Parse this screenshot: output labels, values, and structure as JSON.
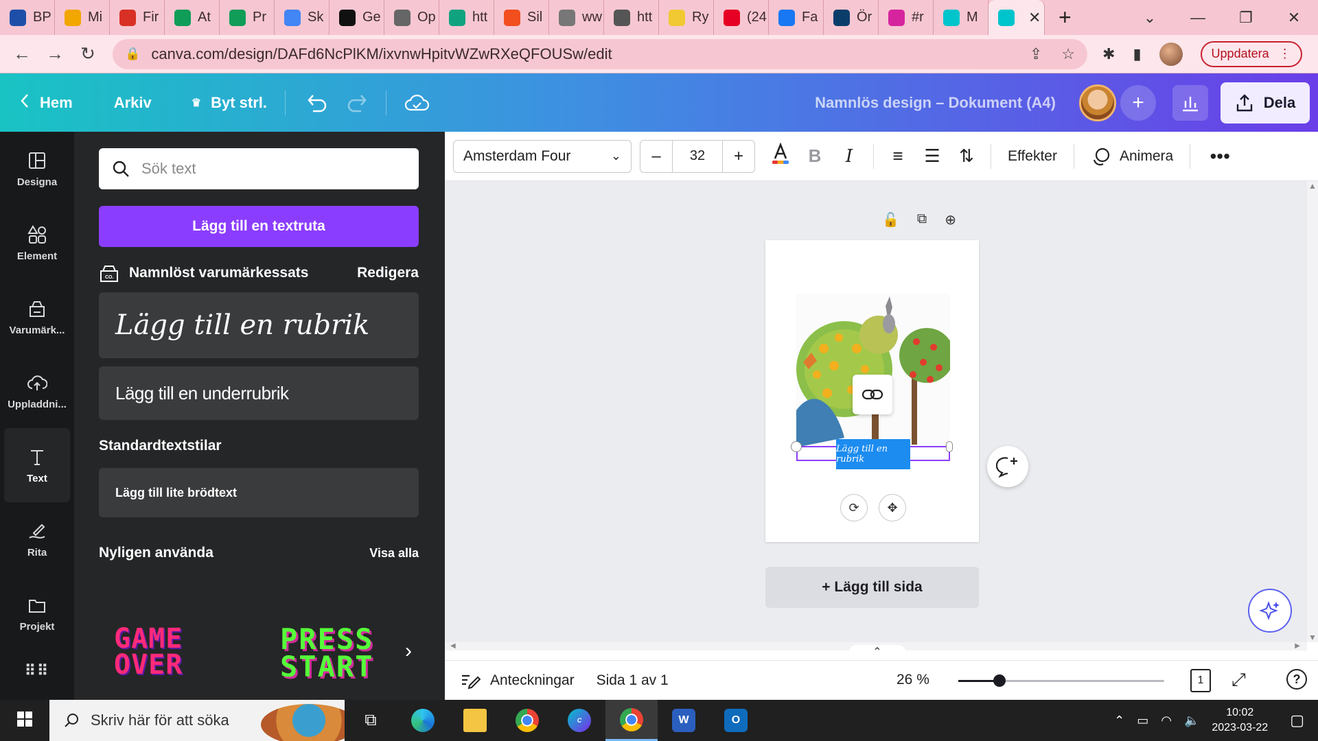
{
  "browser": {
    "tabs": [
      {
        "label": "BP",
        "icon": "bp-icon",
        "color": "#1e4fa8"
      },
      {
        "label": "Mi",
        "icon": "drive-icon",
        "color": "#f2a600"
      },
      {
        "label": "Fir",
        "icon": "gmail-icon",
        "color": "#d93025"
      },
      {
        "label": "At",
        "icon": "sheets-icon",
        "color": "#0f9d58"
      },
      {
        "label": "Pr",
        "icon": "sheets-icon",
        "color": "#0f9d58"
      },
      {
        "label": "Sk",
        "icon": "docs-icon",
        "color": "#4285f4"
      },
      {
        "label": "Ge",
        "icon": "notion-icon",
        "color": "#111111"
      },
      {
        "label": "Op",
        "icon": "book-icon",
        "color": "#666666"
      },
      {
        "label": "htt",
        "icon": "chatgpt-icon",
        "color": "#10a37f"
      },
      {
        "label": "Sil",
        "icon": "f-icon",
        "color": "#f24e1e"
      },
      {
        "label": "ww",
        "icon": "globe-icon",
        "color": "#777777"
      },
      {
        "label": "htt",
        "icon": "globe-icon",
        "color": "#555555"
      },
      {
        "label": "Ry",
        "icon": "ryanair-icon",
        "color": "#f1c933"
      },
      {
        "label": "(24",
        "icon": "pinterest-icon",
        "color": "#e60023"
      },
      {
        "label": "Fa",
        "icon": "facebook-icon",
        "color": "#1877f2"
      },
      {
        "label": "Ör",
        "icon": "h-icon",
        "color": "#0b3d6b"
      },
      {
        "label": "#r",
        "icon": "instagram-icon",
        "color": "#d6249f"
      },
      {
        "label": "M",
        "icon": "canva-icon",
        "color": "#00c4cc"
      },
      {
        "label": "",
        "icon": "canva-icon",
        "color": "#00c4cc",
        "active": true
      }
    ],
    "url": "canva.com/design/DAFd6NcPlKM/ixvnwHpitvWZwRXeQFOUSw/edit",
    "update_label": "Uppdatera"
  },
  "header": {
    "home": "Hem",
    "file": "Arkiv",
    "resize": "Byt strl.",
    "doc_title": "Namnlös design – Dokument (A4)",
    "share": "Dela"
  },
  "rail": {
    "items": [
      {
        "label": "Designa",
        "icon": "design-icon"
      },
      {
        "label": "Element",
        "icon": "elements-icon"
      },
      {
        "label": "Varumärk...",
        "icon": "brand-icon"
      },
      {
        "label": "Uppladdni...",
        "icon": "upload-icon"
      },
      {
        "label": "Text",
        "icon": "text-icon",
        "active": true
      },
      {
        "label": "Rita",
        "icon": "draw-icon"
      },
      {
        "label": "Projekt",
        "icon": "folder-icon"
      }
    ]
  },
  "panel": {
    "search_placeholder": "Sök text",
    "add_textbox": "Lägg till en textruta",
    "brand_kit": "Namnlöst varumärkessats",
    "edit": "Redigera",
    "heading_sample": "Lägg till en rubrik",
    "subheading_sample": "Lägg till en underrubrik",
    "standard_styles": "Standardtextstilar",
    "body_sample": "Lägg till lite brödtext",
    "recent": "Nyligen använda",
    "show_all": "Visa alla",
    "font_previews": [
      "GAME OVER",
      "PRESS START"
    ]
  },
  "toolbar": {
    "font": "Amsterdam Four",
    "size": "32",
    "effects": "Effekter",
    "animate": "Animera"
  },
  "canvas": {
    "selected_text": "Lägg till en rubrik",
    "add_page": "+ Lägg till sida"
  },
  "footer": {
    "notes": "Anteckningar",
    "page": "Sida 1 av 1",
    "zoom": "26 %",
    "zoom_level": 0.26,
    "page_count": "1"
  },
  "taskbar": {
    "search": "Skriv här för att söka",
    "time": "10:02",
    "date": "2023-03-22"
  }
}
